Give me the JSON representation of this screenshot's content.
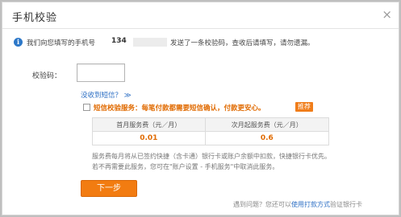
{
  "dialog": {
    "title": "手机校验",
    "close_glyph": "×"
  },
  "info": {
    "icon_glyph": "i",
    "text_before": "我们向您填写的手机号",
    "phone_prefix": "134",
    "text_after": "发送了一条校验码，查收后请填写，请勿遗漏。"
  },
  "form": {
    "code_label": "校验码：",
    "code_value": "",
    "no_sms_link": "没收到短信？",
    "no_sms_chevron": "≫"
  },
  "sms_service": {
    "label": "短信校验服务：每笔付款都需要短信确认，付款更安心。",
    "badge": "推荐",
    "checked": false,
    "table_headers": [
      "首月服务费（元／月）",
      "次月起服务费（元／月）"
    ],
    "table_values": [
      "0.01",
      "0.6"
    ],
    "description_line1": "服务费每月将从已签约快捷（含卡通）银行卡或账户余额中扣款，快捷银行卡优先。",
    "description_line2": "若不再需要此服务，您可在\"账户设置 - 手机服务\"中取消此服务。"
  },
  "actions": {
    "next_label": "下一步"
  },
  "footer": {
    "text_before": "遇到问题？您还可以",
    "link_text": "使用打款方式",
    "text_after": "验证银行卡"
  },
  "colors": {
    "accent_orange": "#f27c11",
    "link_blue": "#2d6fc4",
    "warning_orange": "#e06a00"
  }
}
